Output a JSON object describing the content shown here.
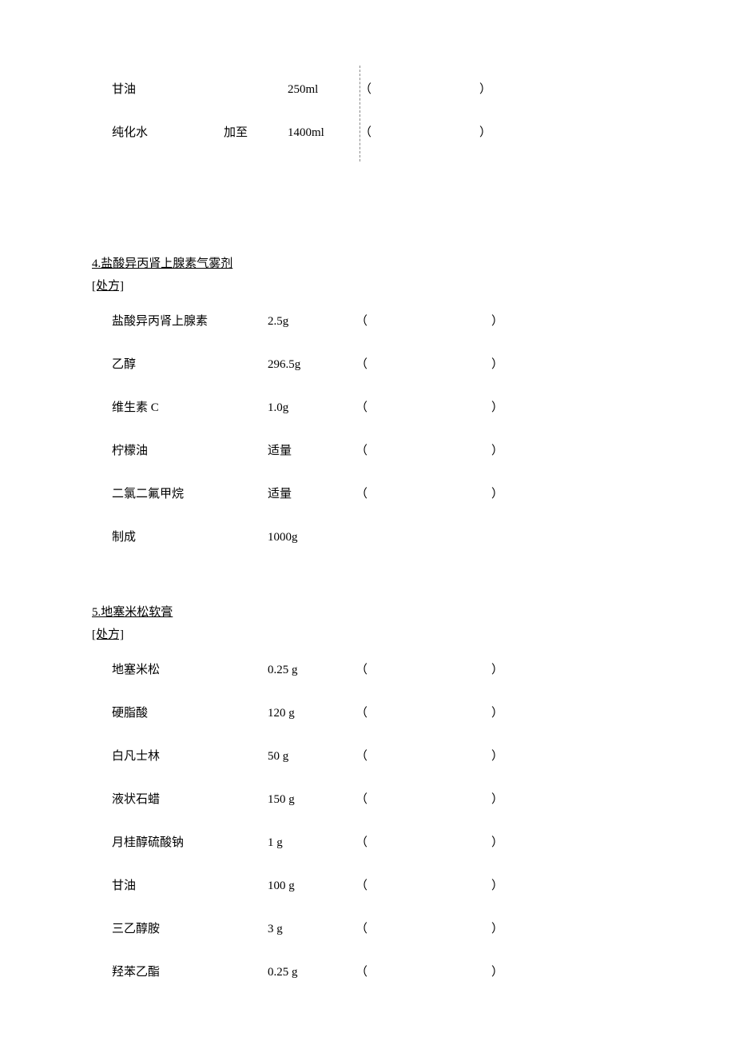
{
  "top": {
    "rows": [
      {
        "name": "甘油",
        "mid": "",
        "amount": "250ml",
        "paren": true
      },
      {
        "name": "纯化水",
        "mid": "加至",
        "amount": "1400ml",
        "paren": true
      }
    ]
  },
  "sections": [
    {
      "title": "4.盐酸异丙肾上腺素气雾剂",
      "rx": "[处方]",
      "rows": [
        {
          "name": "盐酸异丙肾上腺素",
          "amount": "2.5g",
          "paren": true
        },
        {
          "name": "乙醇",
          "amount": "296.5g",
          "paren": true
        },
        {
          "name": "维生素 C",
          "amount": "1.0g",
          "paren": true
        },
        {
          "name": "柠檬油",
          "amount": "适量",
          "paren": true
        },
        {
          "name": "二氯二氟甲烷",
          "amount": "适量",
          "paren": true
        },
        {
          "name": "制成",
          "amount": "1000g",
          "paren": false
        }
      ]
    },
    {
      "title": "5.地塞米松软膏",
      "rx": "[处方]",
      "rows": [
        {
          "name": "地塞米松",
          "amount": "0.25 g",
          "paren": true
        },
        {
          "name": "硬脂酸",
          "amount": "120 g",
          "paren": true
        },
        {
          "name": "白凡士林",
          "amount": "50 g",
          "paren": true
        },
        {
          "name": "液状石蜡",
          "amount": "150 g",
          "paren": true
        },
        {
          "name": "月桂醇硫酸钠",
          "amount": "1 g",
          "paren": true
        },
        {
          "name": "甘油",
          "amount": "100 g",
          "paren": true
        },
        {
          "name": "三乙醇胺",
          "amount": "3 g",
          "paren": true
        },
        {
          "name": "羟苯乙酯",
          "amount": "0.25 g",
          "paren": true
        }
      ]
    }
  ],
  "parenOpen": "（",
  "parenClose": "）"
}
